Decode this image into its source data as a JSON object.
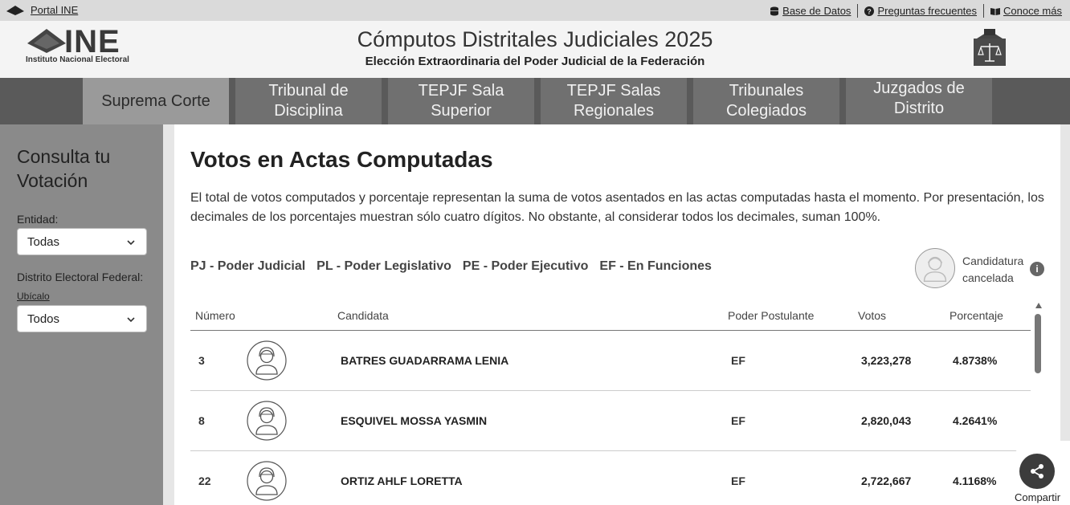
{
  "topbar": {
    "portal_label": "Portal INE",
    "links": [
      {
        "label": "Base de Datos",
        "icon": "database-icon"
      },
      {
        "label": "Preguntas frecuentes",
        "icon": "question-circle-icon"
      },
      {
        "label": "Conoce más",
        "icon": "book-open-icon"
      }
    ]
  },
  "header": {
    "logo_brand": "INE",
    "logo_tagline": "Instituto Nacional Electoral",
    "title": "Cómputos Distritales Judiciales 2025",
    "subtitle": "Elección Extraordinaria del Poder Judicial de la Federación",
    "right_icon": "ballot-box-scale-icon"
  },
  "nav": {
    "tabs": [
      {
        "line1": "Suprema Corte",
        "line2": "",
        "active": true
      },
      {
        "line1": "Tribunal de",
        "line2": "Disciplina",
        "active": false
      },
      {
        "line1": "TEPJF Sala",
        "line2": "Superior",
        "active": false
      },
      {
        "line1": "TEPJF Salas",
        "line2": "Regionales",
        "active": false
      },
      {
        "line1": "Tribunales",
        "line2": "Colegiados",
        "active": false
      },
      {
        "line1": "Juzgados de",
        "line2": "Distrito",
        "active": false
      }
    ]
  },
  "sidebar": {
    "title_line1": "Consulta tu",
    "title_line2": "Votación",
    "entidad_label": "Entidad:",
    "entidad_value": "Todas",
    "distrito_label": "Distrito Electoral Federal:",
    "ubicalo_link": "Ubícalo",
    "distrito_value": "Todos"
  },
  "main": {
    "heading": "Votos en Actas Computadas",
    "description": "El total de votos computados y porcentaje representan la suma de votos asentados en las actas computadas hasta el momento. Por presentación, los decimales de los porcentajes muestran sólo cuatro dígitos. No obstante, al considerar todos los decimales, suman 100%.",
    "legend": [
      "PJ - Poder Judicial",
      "PL - Poder Legislativo",
      "PE - Poder Ejecutivo",
      "EF - En Funciones"
    ],
    "cancel_line1": "Candidatura",
    "cancel_line2": "cancelada",
    "info_glyph": "i",
    "columns": {
      "numero": "Número",
      "candidata": "Candidata",
      "poder": "Poder Postulante",
      "votos": "Votos",
      "porcentaje": "Porcentaje"
    },
    "rows": [
      {
        "numero": "3",
        "candidata": "BATRES GUADARRAMA LENIA",
        "poder": "EF",
        "votos": "3,223,278",
        "porcentaje": "4.8738%"
      },
      {
        "numero": "8",
        "candidata": "ESQUIVEL MOSSA YASMIN",
        "poder": "EF",
        "votos": "2,820,043",
        "porcentaje": "4.2641%"
      },
      {
        "numero": "22",
        "candidata": "ORTIZ AHLF LORETTA",
        "poder": "EF",
        "votos": "2,722,667",
        "porcentaje": "4.1168%"
      }
    ]
  },
  "share": {
    "label": "Compartir",
    "icon": "share-icon"
  }
}
